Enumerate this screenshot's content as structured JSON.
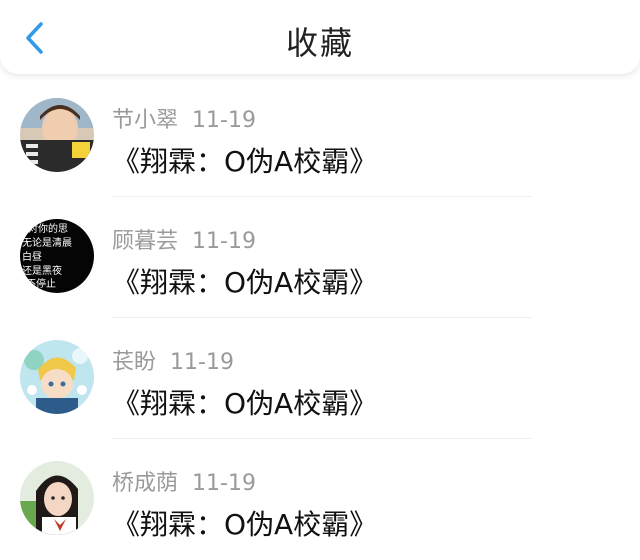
{
  "header": {
    "title": "收藏",
    "back_icon": "chevron-left-icon",
    "accent": "#2f9be8"
  },
  "favorites": [
    {
      "name": "节小翠",
      "time": "11-19",
      "book": "《翔霖：O伪A校霸》"
    },
    {
      "name": "顾暮芸",
      "time": "11-19",
      "book": "《翔霖：O伪A校霸》"
    },
    {
      "name": "苌盼",
      "time": "11-19",
      "book": "《翔霖：O伪A校霸》"
    },
    {
      "name": "桥成荫",
      "time": "11-19",
      "book": "《翔霖：O伪A校霸》"
    }
  ],
  "avatar_texts": {
    "line1": "对你的思",
    "line2": "无论是清晨",
    "line3": "白昼",
    "line4": "还是黑夜",
    "line5": "不停止"
  }
}
